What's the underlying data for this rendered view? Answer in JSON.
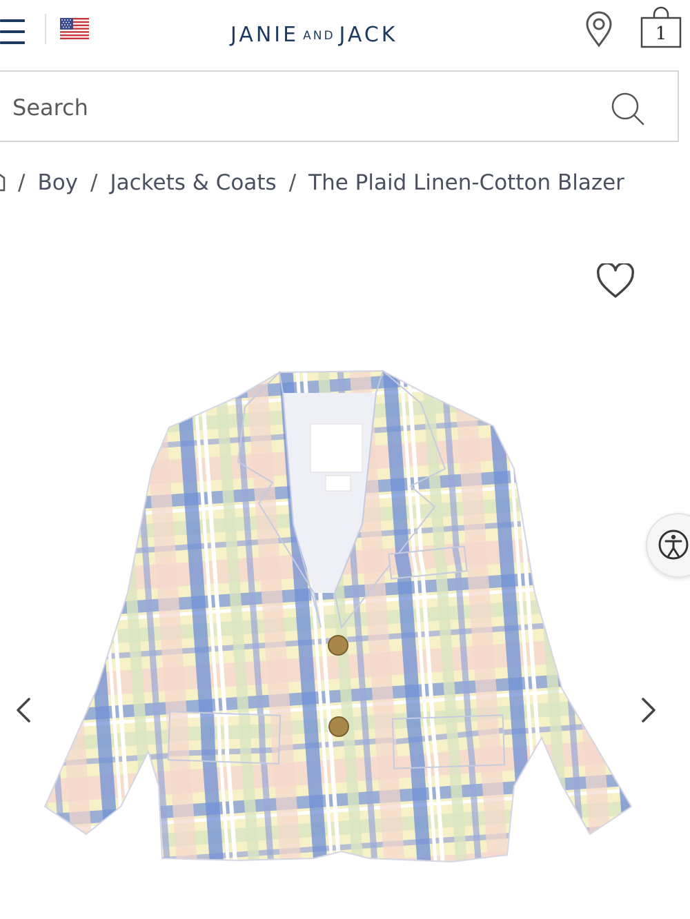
{
  "header": {
    "brand": {
      "part1": "JANIE",
      "part2": "AND",
      "part3": "JACK"
    },
    "cart_count": "1",
    "icons": [
      "menu-icon",
      "us-flag-icon",
      "location-pin-icon",
      "shopping-bag-icon"
    ]
  },
  "search": {
    "placeholder": "Search"
  },
  "breadcrumb": {
    "items": [
      "Boy",
      "Jackets & Coats",
      "The Plaid Linen-Cotton Blazer"
    ],
    "separator": "/"
  },
  "gallery": {
    "icons": [
      "heart-icon",
      "chevron-left-icon",
      "chevron-right-icon",
      "accessibility-icon"
    ]
  },
  "colors": {
    "brand_navy": "#1f3a5f",
    "plaid_blue": "#6f8fd6",
    "plaid_yellow": "#f3efb8",
    "plaid_pink": "#f6cfc4"
  }
}
